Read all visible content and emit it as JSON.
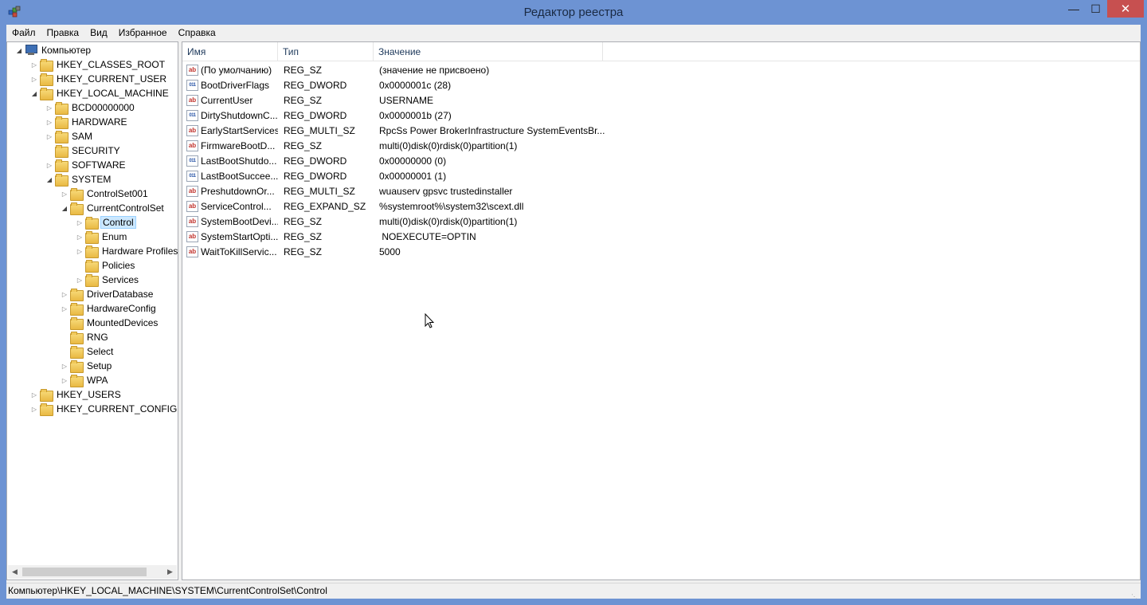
{
  "window": {
    "title": "Редактор реестра",
    "accent_color": "#6d93d3",
    "close_color": "#c75050",
    "controls": {
      "minimize": "—",
      "maximize": "☐",
      "close": "✕"
    }
  },
  "menu": [
    "Файл",
    "Правка",
    "Вид",
    "Избранное",
    "Справка"
  ],
  "tree": {
    "root": "Компьютер",
    "nodes": [
      {
        "label": "HKEY_CLASSES_ROOT",
        "level": 1,
        "state": "collapsed"
      },
      {
        "label": "HKEY_CURRENT_USER",
        "level": 1,
        "state": "collapsed"
      },
      {
        "label": "HKEY_LOCAL_MACHINE",
        "level": 1,
        "state": "expanded"
      },
      {
        "label": "BCD00000000",
        "level": 2,
        "state": "collapsed"
      },
      {
        "label": "HARDWARE",
        "level": 2,
        "state": "collapsed"
      },
      {
        "label": "SAM",
        "level": 2,
        "state": "collapsed"
      },
      {
        "label": "SECURITY",
        "level": 2,
        "state": "leaf"
      },
      {
        "label": "SOFTWARE",
        "level": 2,
        "state": "collapsed"
      },
      {
        "label": "SYSTEM",
        "level": 2,
        "state": "expanded"
      },
      {
        "label": "ControlSet001",
        "level": 3,
        "state": "collapsed"
      },
      {
        "label": "CurrentControlSet",
        "level": 3,
        "state": "expanded"
      },
      {
        "label": "Control",
        "level": 4,
        "state": "collapsed",
        "selected": true
      },
      {
        "label": "Enum",
        "level": 4,
        "state": "collapsed"
      },
      {
        "label": "Hardware Profiles",
        "level": 4,
        "state": "collapsed"
      },
      {
        "label": "Policies",
        "level": 4,
        "state": "leaf"
      },
      {
        "label": "Services",
        "level": 4,
        "state": "collapsed"
      },
      {
        "label": "DriverDatabase",
        "level": 3,
        "state": "collapsed"
      },
      {
        "label": "HardwareConfig",
        "level": 3,
        "state": "collapsed"
      },
      {
        "label": "MountedDevices",
        "level": 3,
        "state": "leaf"
      },
      {
        "label": "RNG",
        "level": 3,
        "state": "leaf"
      },
      {
        "label": "Select",
        "level": 3,
        "state": "leaf"
      },
      {
        "label": "Setup",
        "level": 3,
        "state": "collapsed"
      },
      {
        "label": "WPA",
        "level": 3,
        "state": "collapsed"
      },
      {
        "label": "HKEY_USERS",
        "level": 1,
        "state": "collapsed"
      },
      {
        "label": "HKEY_CURRENT_CONFIG",
        "level": 1,
        "state": "collapsed"
      }
    ]
  },
  "list": {
    "columns": [
      "Имя",
      "Тип",
      "Значение"
    ],
    "rows": [
      {
        "name": "(По умолчанию)",
        "type": "REG_SZ",
        "value": "(значение не присвоено)",
        "icon": "string-value-icon"
      },
      {
        "name": "BootDriverFlags",
        "type": "REG_DWORD",
        "value": "0x0000001c (28)",
        "icon": "binary-value-icon"
      },
      {
        "name": "CurrentUser",
        "type": "REG_SZ",
        "value": "USERNAME",
        "icon": "string-value-icon"
      },
      {
        "name": "DirtyShutdownC...",
        "type": "REG_DWORD",
        "value": "0x0000001b (27)",
        "icon": "binary-value-icon"
      },
      {
        "name": "EarlyStartServices",
        "type": "REG_MULTI_SZ",
        "value": "RpcSs Power BrokerInfrastructure SystemEventsBr...",
        "icon": "string-value-icon"
      },
      {
        "name": "FirmwareBootD...",
        "type": "REG_SZ",
        "value": "multi(0)disk(0)rdisk(0)partition(1)",
        "icon": "string-value-icon"
      },
      {
        "name": "LastBootShutdo...",
        "type": "REG_DWORD",
        "value": "0x00000000 (0)",
        "icon": "binary-value-icon"
      },
      {
        "name": "LastBootSuccee...",
        "type": "REG_DWORD",
        "value": "0x00000001 (1)",
        "icon": "binary-value-icon"
      },
      {
        "name": "PreshutdownOr...",
        "type": "REG_MULTI_SZ",
        "value": "wuauserv gpsvc trustedinstaller",
        "icon": "string-value-icon"
      },
      {
        "name": "ServiceControl...",
        "type": "REG_EXPAND_SZ",
        "value": "%systemroot%\\system32\\scext.dll",
        "icon": "string-value-icon"
      },
      {
        "name": "SystemBootDevi...",
        "type": "REG_SZ",
        "value": "multi(0)disk(0)rdisk(0)partition(1)",
        "icon": "string-value-icon"
      },
      {
        "name": "SystemStartOpti...",
        "type": "REG_SZ",
        "value": " NOEXECUTE=OPTIN",
        "icon": "string-value-icon"
      },
      {
        "name": "WaitToKillServic...",
        "type": "REG_SZ",
        "value": "5000",
        "icon": "string-value-icon"
      }
    ]
  },
  "icon_glyphs": {
    "string": "ab",
    "binary": "011"
  },
  "status": {
    "path": "Компьютер\\HKEY_LOCAL_MACHINE\\SYSTEM\\CurrentControlSet\\Control"
  }
}
